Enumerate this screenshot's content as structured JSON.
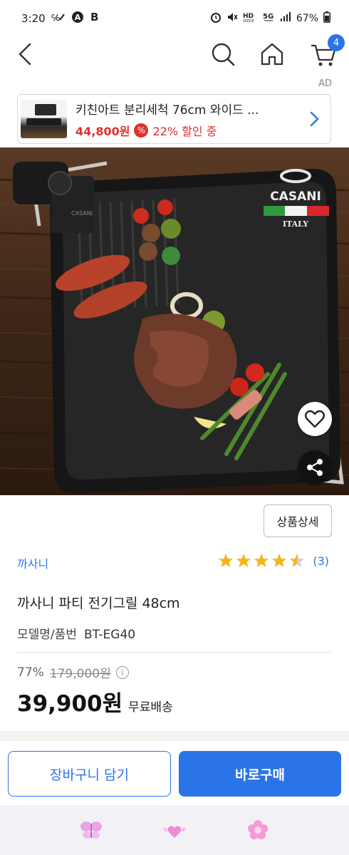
{
  "status_bar": {
    "time": "3:20",
    "battery": "67%",
    "left_icons": [
      "signal-voice-icon",
      "a-circle-icon",
      "b-app-icon"
    ],
    "right_icons": [
      "alarm-icon",
      "mute-icon",
      "hd-voice-icon",
      "5g-icon",
      "signal-bars-icon",
      "battery-icon"
    ]
  },
  "nav": {
    "cart_count": "4",
    "icons": [
      "back-arrow-icon",
      "search-icon",
      "home-icon",
      "cart-icon"
    ]
  },
  "ad": {
    "tag": "AD",
    "title": "키친아트 분리세척 76cm 와이드 ...",
    "price": "44,800원",
    "discount": "22% 할인 중",
    "discount_icon": "%"
  },
  "hero": {
    "logo_text": "CASANI",
    "logo_sub": "ITALY",
    "grill_label": "CASANI"
  },
  "detail_button": "상품상세",
  "brand": "까사니",
  "rating": {
    "score": 4.5,
    "count": "(3)",
    "colors": {
      "star": "#f5b31b",
      "empty": "#d0d0d0"
    }
  },
  "product_name": "까사니 파티 전기그릴 48cm",
  "model": {
    "label": "모델명/품번",
    "value": "BT-EG40"
  },
  "pricing": {
    "discount_rate": "77%",
    "original_price": "179,000원",
    "price": "39,900원",
    "shipping": "무료배송",
    "info_icon": "i"
  },
  "actions": {
    "cart": "장바구니 담기",
    "buy": "바로구매"
  },
  "colors": {
    "accent": "#2b74e8",
    "sale": "#e2302a"
  },
  "bottom_bar": {
    "icons": [
      "butterfly-icon",
      "heart-wings-icon",
      "flower-icon"
    ]
  }
}
